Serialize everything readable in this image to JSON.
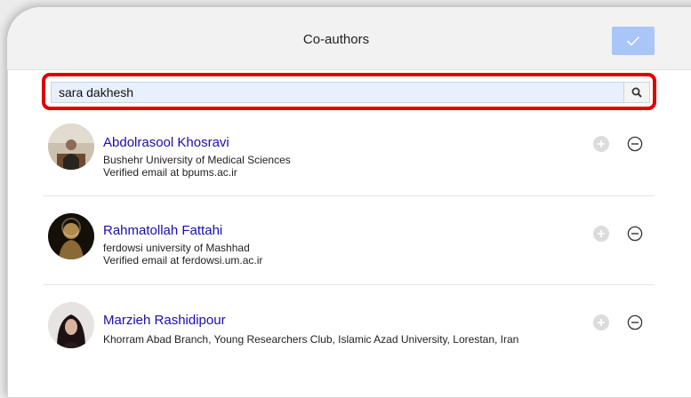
{
  "dialog": {
    "title": "Co-authors",
    "done_icon": "checkmark-icon"
  },
  "search": {
    "value": "sara dakhesh",
    "icon": "search-icon"
  },
  "authors": [
    {
      "name": "Abdolrasool Khosravi",
      "affiliation": "Bushehr University of Medical Sciences",
      "email": "Verified email at bpums.ac.ir"
    },
    {
      "name": "Rahmatollah Fattahi",
      "affiliation": "ferdowsi university of Mashhad",
      "email": "Verified email at ferdowsi.um.ac.ir"
    },
    {
      "name": "Marzieh Rashidipour",
      "affiliation": "Khorram Abad Branch, Young Researchers Club, Islamic Azad University, Lorestan, Iran",
      "email": ""
    }
  ],
  "colors": {
    "accent": "#aac5f7",
    "highlight": "#e00000",
    "link": "#1a0dab"
  }
}
